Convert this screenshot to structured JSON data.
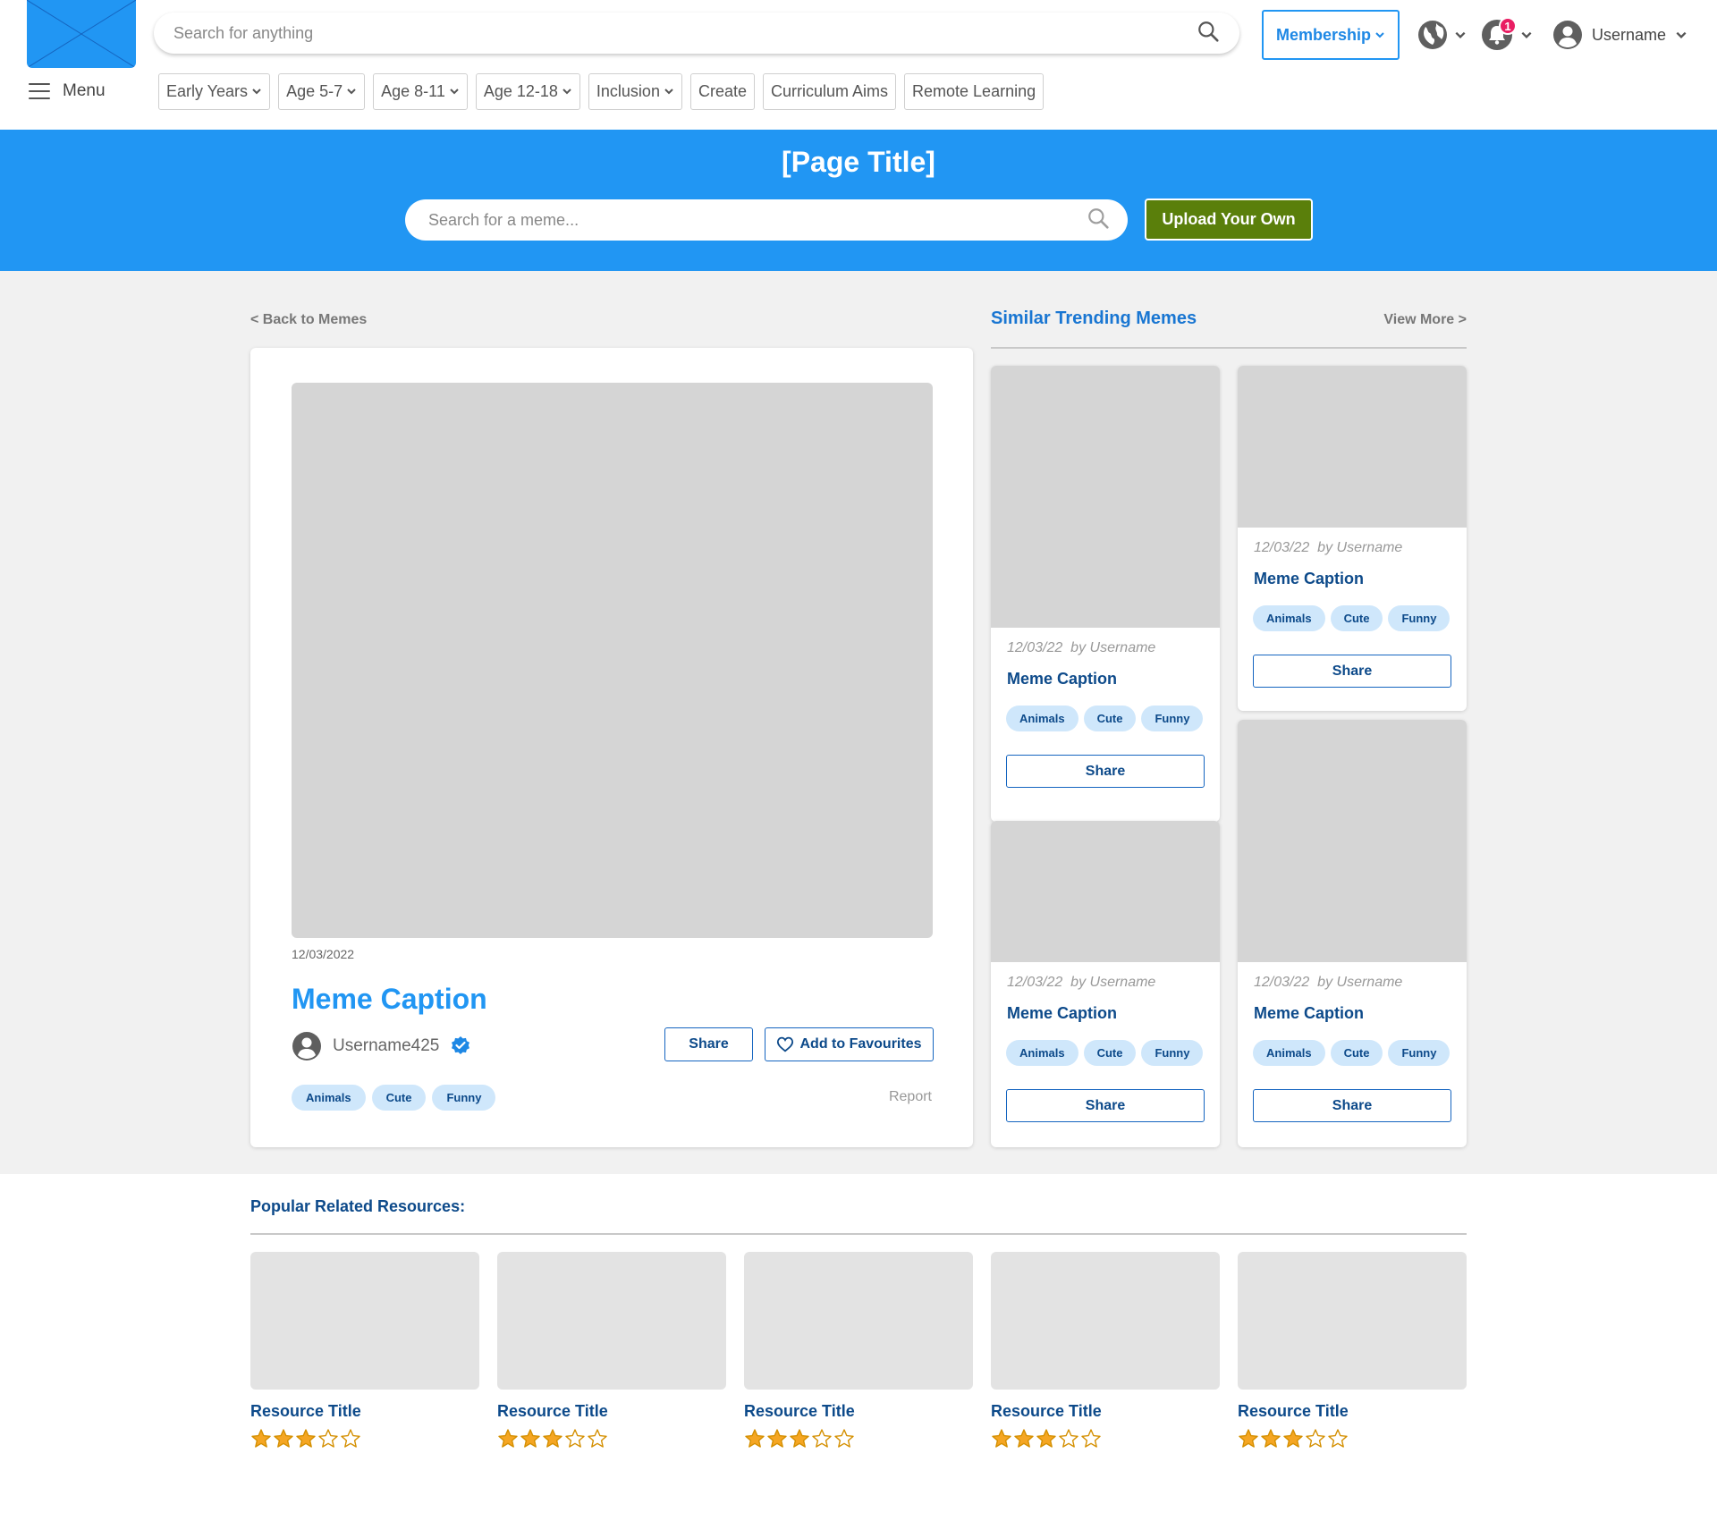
{
  "header": {
    "search_placeholder": "Search for anything",
    "menu_label": "Menu",
    "membership_label": "Membership",
    "notification_count": "1",
    "username": "Username",
    "nav_tabs": [
      {
        "label": "Early Years",
        "has_dropdown": true
      },
      {
        "label": "Age 5-7",
        "has_dropdown": true
      },
      {
        "label": "Age 8-11",
        "has_dropdown": true
      },
      {
        "label": "Age 12-18",
        "has_dropdown": true
      },
      {
        "label": "Inclusion",
        "has_dropdown": true
      },
      {
        "label": "Create",
        "has_dropdown": false
      },
      {
        "label": "Curriculum Aims",
        "has_dropdown": false
      },
      {
        "label": "Remote Learning",
        "has_dropdown": false
      }
    ]
  },
  "hero": {
    "page_title": "[Page Title]",
    "search_placeholder": "Search for a meme...",
    "upload_label": "Upload Your Own"
  },
  "main": {
    "back_label": "< Back to Memes",
    "detail": {
      "date": "12/03/2022",
      "caption": "Meme Caption",
      "username": "Username425",
      "share_label": "Share",
      "favourite_label": "Add to Favourites",
      "tags": [
        "Animals",
        "Cute",
        "Funny"
      ],
      "report_label": "Report"
    },
    "similar": {
      "title": "Similar Trending Memes",
      "view_more_label": "View More >",
      "cards": [
        {
          "date": "12/03/22",
          "by": "by Username",
          "caption": "Meme Caption",
          "tags": [
            "Animals",
            "Cute",
            "Funny"
          ],
          "share_label": "Share"
        },
        {
          "date": "12/03/22",
          "by": "by Username",
          "caption": "Meme Caption",
          "tags": [
            "Animals",
            "Cute",
            "Funny"
          ],
          "share_label": "Share"
        },
        {
          "date": "12/03/22",
          "by": "by Username",
          "caption": "Meme Caption",
          "tags": [
            "Animals",
            "Cute",
            "Funny"
          ],
          "share_label": "Share"
        },
        {
          "date": "12/03/22",
          "by": "by Username",
          "caption": "Meme Caption",
          "tags": [
            "Animals",
            "Cute",
            "Funny"
          ],
          "share_label": "Share"
        }
      ]
    }
  },
  "popular": {
    "title": "Popular Related Resources:",
    "resources": [
      {
        "title": "Resource Title",
        "rating": 3,
        "max_rating": 5
      },
      {
        "title": "Resource Title",
        "rating": 3,
        "max_rating": 5
      },
      {
        "title": "Resource Title",
        "rating": 3,
        "max_rating": 5
      },
      {
        "title": "Resource Title",
        "rating": 3,
        "max_rating": 5
      },
      {
        "title": "Resource Title",
        "rating": 3,
        "max_rating": 5
      }
    ]
  },
  "colors": {
    "brand_blue": "#2196f3",
    "dark_blue": "#0d4a8a",
    "upload_green": "#5a7f0b",
    "tag_bg": "#cfe7fb",
    "badge_pink": "#e91e63",
    "star_gold": "#f5a623",
    "verified_blue": "#1e88e5"
  },
  "icons": [
    "logo-placeholder-icon",
    "hamburger-icon",
    "search-icon",
    "chevron-down-icon",
    "globe-icon",
    "bell-icon",
    "user-avatar-icon",
    "verified-badge-icon",
    "heart-icon",
    "star-icon"
  ]
}
